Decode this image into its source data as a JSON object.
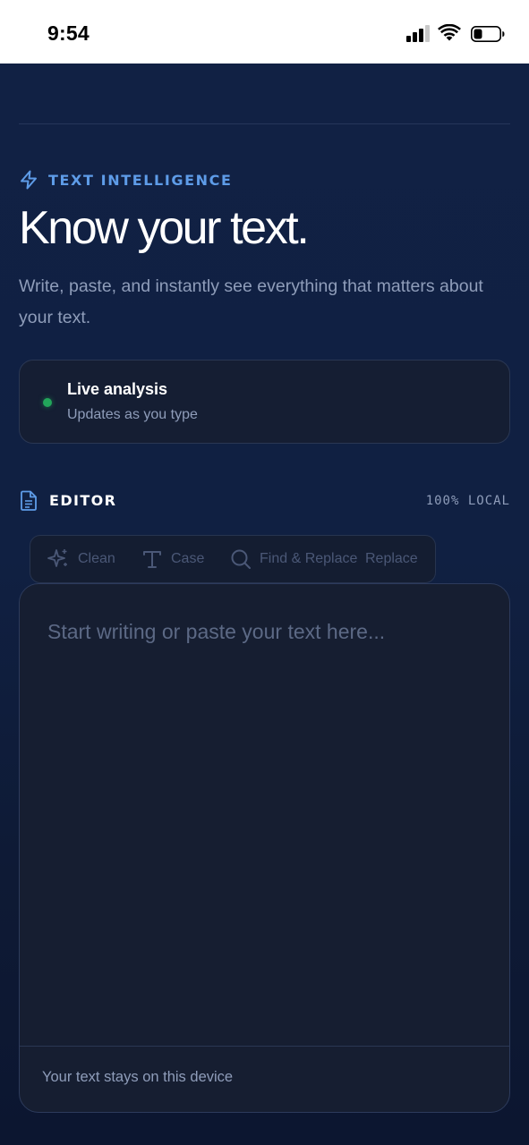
{
  "status_bar": {
    "time": "9:54",
    "icons": [
      "cellular-signal-icon",
      "wifi-icon",
      "battery-icon"
    ]
  },
  "eyebrow": {
    "icon": "lightning-bolt-icon",
    "label": "TEXT INTELLIGENCE"
  },
  "hero": {
    "title": "Know your text.",
    "subtitle": "Write, paste, and instantly see everything that matters about your text."
  },
  "live_card": {
    "title": "Live analysis",
    "subtitle": "Updates as you type",
    "status_color": "#22a55a"
  },
  "editor": {
    "icon": "document-icon",
    "label": "EDITOR",
    "badge": "100% LOCAL",
    "toolbar": [
      {
        "label": "Clean",
        "icon": "sparkle-icon"
      },
      {
        "label": "Case",
        "icon": "text-type-icon"
      },
      {
        "label": "Find & Replace",
        "icon": "search-icon"
      },
      {
        "label": "Replace",
        "icon": ""
      }
    ],
    "placeholder": "Start writing or paste your text here...",
    "footer": "Your text stays on this device"
  },
  "colors": {
    "accent": "#5e9ce8",
    "background": "#112144",
    "card": "#151e33"
  }
}
